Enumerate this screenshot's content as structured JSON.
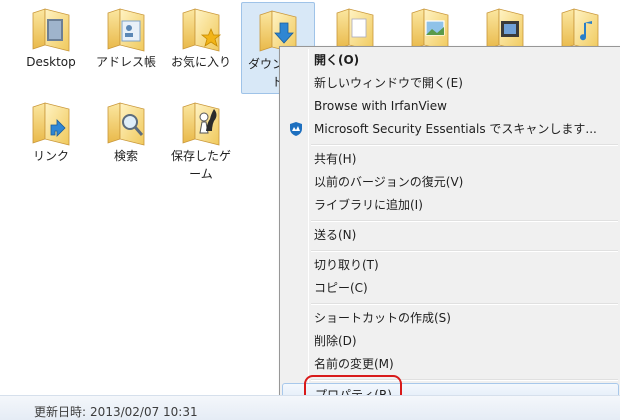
{
  "folders": [
    {
      "label": "Desktop",
      "icon": "desktop-folder-icon"
    },
    {
      "label": "アドレス帳",
      "icon": "contacts-folder-icon"
    },
    {
      "label": "お気に入り",
      "icon": "favorites-folder-icon"
    },
    {
      "label": "ダウンロード",
      "icon": "downloads-folder-icon"
    },
    {
      "label": "",
      "icon": "documents-folder-icon"
    },
    {
      "label": "",
      "icon": "pictures-folder-icon"
    },
    {
      "label": "",
      "icon": "videos-folder-icon"
    },
    {
      "label": "",
      "icon": "music-folder-icon"
    },
    {
      "label": "リンク",
      "icon": "links-folder-icon"
    },
    {
      "label": "検索",
      "icon": "searches-folder-icon"
    },
    {
      "label": "保存したゲーム",
      "icon": "saved-games-folder-icon"
    }
  ],
  "context_menu": {
    "items": [
      {
        "label": "開く(O)",
        "bold": true
      },
      {
        "label": "新しいウィンドウで開く(E)"
      },
      {
        "label": "Browse with IrfanView"
      },
      {
        "label": "Microsoft Security Essentials でスキャンします...",
        "icon": "security-essentials-icon"
      },
      {
        "label": "共有(H)"
      },
      {
        "label": "以前のバージョンの復元(V)"
      },
      {
        "label": "ライブラリに追加(I)"
      },
      {
        "label": "送る(N)"
      },
      {
        "label": "切り取り(T)"
      },
      {
        "label": "コピー(C)"
      },
      {
        "label": "ショートカットの作成(S)"
      },
      {
        "label": "削除(D)"
      },
      {
        "label": "名前の変更(M)"
      },
      {
        "label": "プロパティ(R)",
        "highlighted": true
      }
    ]
  },
  "status": {
    "modified_label": "更新日時:",
    "modified_value": "2013/02/07 10:31"
  },
  "colors": {
    "folder": "#f5d76e",
    "selection": "#d8e8f7",
    "highlight_box": "#d81a1a"
  }
}
